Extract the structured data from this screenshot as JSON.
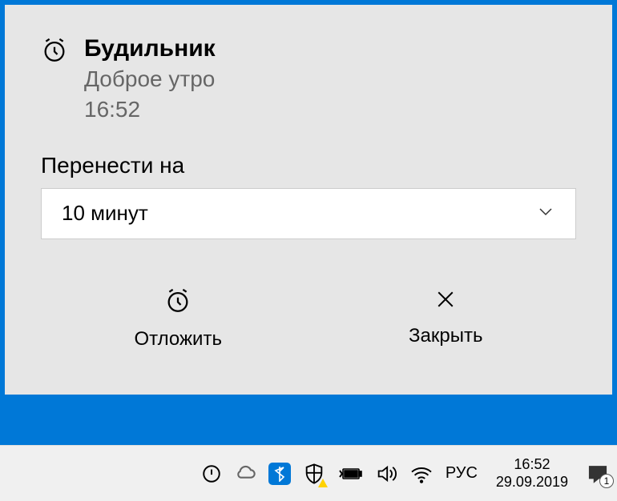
{
  "notification": {
    "title": "Будильник",
    "subtitle": "Доброе утро",
    "time": "16:52",
    "snooze_label": "Перенести на",
    "dropdown_value": "10 минут",
    "actions": {
      "snooze": "Отложить",
      "close": "Закрыть"
    }
  },
  "taskbar": {
    "language": "РУС",
    "clock_time": "16:52",
    "clock_date": "29.09.2019",
    "action_center_badge": "1"
  }
}
